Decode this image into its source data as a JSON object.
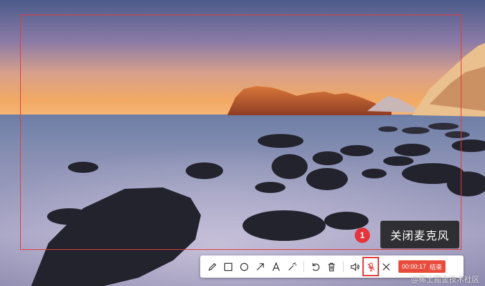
{
  "toolbar": {
    "tools": [
      {
        "icon": "pencil-icon"
      },
      {
        "icon": "rectangle-icon"
      },
      {
        "icon": "circle-icon"
      },
      {
        "icon": "arrow-icon"
      },
      {
        "icon": "text-icon"
      },
      {
        "icon": "magic-wand-icon"
      },
      {
        "icon": "undo-icon"
      },
      {
        "icon": "trash-icon"
      },
      {
        "icon": "speaker-icon"
      },
      {
        "icon": "microphone-off-icon"
      },
      {
        "icon": "close-icon"
      }
    ],
    "timer": "00:00:17",
    "end_label": "结束"
  },
  "tooltip": {
    "step": "1",
    "text": "关闭麦克风"
  },
  "watermark": "@稀土掘金技术社区",
  "colors": {
    "accent_red": "#e23b3b",
    "record_badge": "#e84b3c"
  }
}
